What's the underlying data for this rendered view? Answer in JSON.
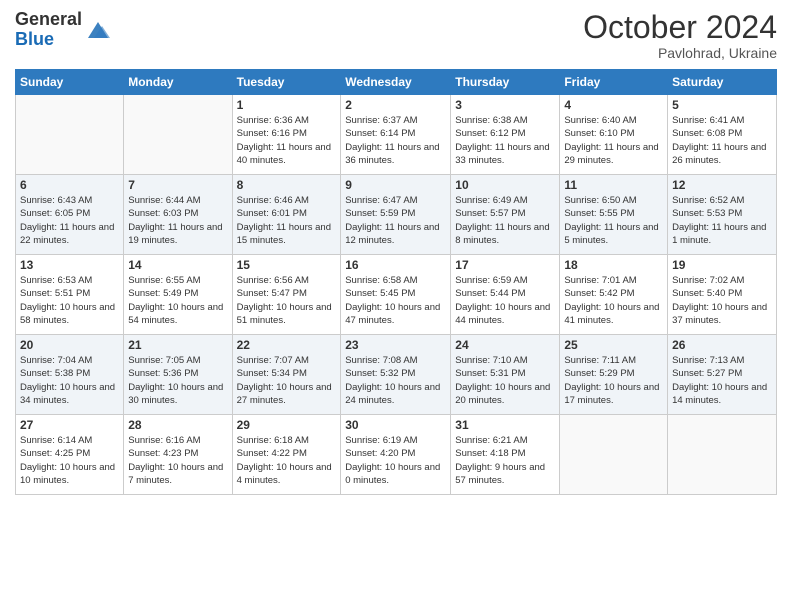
{
  "logo": {
    "general": "General",
    "blue": "Blue"
  },
  "title": "October 2024",
  "location": "Pavlohrad, Ukraine",
  "headers": [
    "Sunday",
    "Monday",
    "Tuesday",
    "Wednesday",
    "Thursday",
    "Friday",
    "Saturday"
  ],
  "weeks": [
    [
      {
        "day": "",
        "sunrise": "",
        "sunset": "",
        "daylight": ""
      },
      {
        "day": "",
        "sunrise": "",
        "sunset": "",
        "daylight": ""
      },
      {
        "day": "1",
        "sunrise": "Sunrise: 6:36 AM",
        "sunset": "Sunset: 6:16 PM",
        "daylight": "Daylight: 11 hours and 40 minutes."
      },
      {
        "day": "2",
        "sunrise": "Sunrise: 6:37 AM",
        "sunset": "Sunset: 6:14 PM",
        "daylight": "Daylight: 11 hours and 36 minutes."
      },
      {
        "day": "3",
        "sunrise": "Sunrise: 6:38 AM",
        "sunset": "Sunset: 6:12 PM",
        "daylight": "Daylight: 11 hours and 33 minutes."
      },
      {
        "day": "4",
        "sunrise": "Sunrise: 6:40 AM",
        "sunset": "Sunset: 6:10 PM",
        "daylight": "Daylight: 11 hours and 29 minutes."
      },
      {
        "day": "5",
        "sunrise": "Sunrise: 6:41 AM",
        "sunset": "Sunset: 6:08 PM",
        "daylight": "Daylight: 11 hours and 26 minutes."
      }
    ],
    [
      {
        "day": "6",
        "sunrise": "Sunrise: 6:43 AM",
        "sunset": "Sunset: 6:05 PM",
        "daylight": "Daylight: 11 hours and 22 minutes."
      },
      {
        "day": "7",
        "sunrise": "Sunrise: 6:44 AM",
        "sunset": "Sunset: 6:03 PM",
        "daylight": "Daylight: 11 hours and 19 minutes."
      },
      {
        "day": "8",
        "sunrise": "Sunrise: 6:46 AM",
        "sunset": "Sunset: 6:01 PM",
        "daylight": "Daylight: 11 hours and 15 minutes."
      },
      {
        "day": "9",
        "sunrise": "Sunrise: 6:47 AM",
        "sunset": "Sunset: 5:59 PM",
        "daylight": "Daylight: 11 hours and 12 minutes."
      },
      {
        "day": "10",
        "sunrise": "Sunrise: 6:49 AM",
        "sunset": "Sunset: 5:57 PM",
        "daylight": "Daylight: 11 hours and 8 minutes."
      },
      {
        "day": "11",
        "sunrise": "Sunrise: 6:50 AM",
        "sunset": "Sunset: 5:55 PM",
        "daylight": "Daylight: 11 hours and 5 minutes."
      },
      {
        "day": "12",
        "sunrise": "Sunrise: 6:52 AM",
        "sunset": "Sunset: 5:53 PM",
        "daylight": "Daylight: 11 hours and 1 minute."
      }
    ],
    [
      {
        "day": "13",
        "sunrise": "Sunrise: 6:53 AM",
        "sunset": "Sunset: 5:51 PM",
        "daylight": "Daylight: 10 hours and 58 minutes."
      },
      {
        "day": "14",
        "sunrise": "Sunrise: 6:55 AM",
        "sunset": "Sunset: 5:49 PM",
        "daylight": "Daylight: 10 hours and 54 minutes."
      },
      {
        "day": "15",
        "sunrise": "Sunrise: 6:56 AM",
        "sunset": "Sunset: 5:47 PM",
        "daylight": "Daylight: 10 hours and 51 minutes."
      },
      {
        "day": "16",
        "sunrise": "Sunrise: 6:58 AM",
        "sunset": "Sunset: 5:45 PM",
        "daylight": "Daylight: 10 hours and 47 minutes."
      },
      {
        "day": "17",
        "sunrise": "Sunrise: 6:59 AM",
        "sunset": "Sunset: 5:44 PM",
        "daylight": "Daylight: 10 hours and 44 minutes."
      },
      {
        "day": "18",
        "sunrise": "Sunrise: 7:01 AM",
        "sunset": "Sunset: 5:42 PM",
        "daylight": "Daylight: 10 hours and 41 minutes."
      },
      {
        "day": "19",
        "sunrise": "Sunrise: 7:02 AM",
        "sunset": "Sunset: 5:40 PM",
        "daylight": "Daylight: 10 hours and 37 minutes."
      }
    ],
    [
      {
        "day": "20",
        "sunrise": "Sunrise: 7:04 AM",
        "sunset": "Sunset: 5:38 PM",
        "daylight": "Daylight: 10 hours and 34 minutes."
      },
      {
        "day": "21",
        "sunrise": "Sunrise: 7:05 AM",
        "sunset": "Sunset: 5:36 PM",
        "daylight": "Daylight: 10 hours and 30 minutes."
      },
      {
        "day": "22",
        "sunrise": "Sunrise: 7:07 AM",
        "sunset": "Sunset: 5:34 PM",
        "daylight": "Daylight: 10 hours and 27 minutes."
      },
      {
        "day": "23",
        "sunrise": "Sunrise: 7:08 AM",
        "sunset": "Sunset: 5:32 PM",
        "daylight": "Daylight: 10 hours and 24 minutes."
      },
      {
        "day": "24",
        "sunrise": "Sunrise: 7:10 AM",
        "sunset": "Sunset: 5:31 PM",
        "daylight": "Daylight: 10 hours and 20 minutes."
      },
      {
        "day": "25",
        "sunrise": "Sunrise: 7:11 AM",
        "sunset": "Sunset: 5:29 PM",
        "daylight": "Daylight: 10 hours and 17 minutes."
      },
      {
        "day": "26",
        "sunrise": "Sunrise: 7:13 AM",
        "sunset": "Sunset: 5:27 PM",
        "daylight": "Daylight: 10 hours and 14 minutes."
      }
    ],
    [
      {
        "day": "27",
        "sunrise": "Sunrise: 6:14 AM",
        "sunset": "Sunset: 4:25 PM",
        "daylight": "Daylight: 10 hours and 10 minutes."
      },
      {
        "day": "28",
        "sunrise": "Sunrise: 6:16 AM",
        "sunset": "Sunset: 4:23 PM",
        "daylight": "Daylight: 10 hours and 7 minutes."
      },
      {
        "day": "29",
        "sunrise": "Sunrise: 6:18 AM",
        "sunset": "Sunset: 4:22 PM",
        "daylight": "Daylight: 10 hours and 4 minutes."
      },
      {
        "day": "30",
        "sunrise": "Sunrise: 6:19 AM",
        "sunset": "Sunset: 4:20 PM",
        "daylight": "Daylight: 10 hours and 0 minutes."
      },
      {
        "day": "31",
        "sunrise": "Sunrise: 6:21 AM",
        "sunset": "Sunset: 4:18 PM",
        "daylight": "Daylight: 9 hours and 57 minutes."
      },
      {
        "day": "",
        "sunrise": "",
        "sunset": "",
        "daylight": ""
      },
      {
        "day": "",
        "sunrise": "",
        "sunset": "",
        "daylight": ""
      }
    ]
  ]
}
